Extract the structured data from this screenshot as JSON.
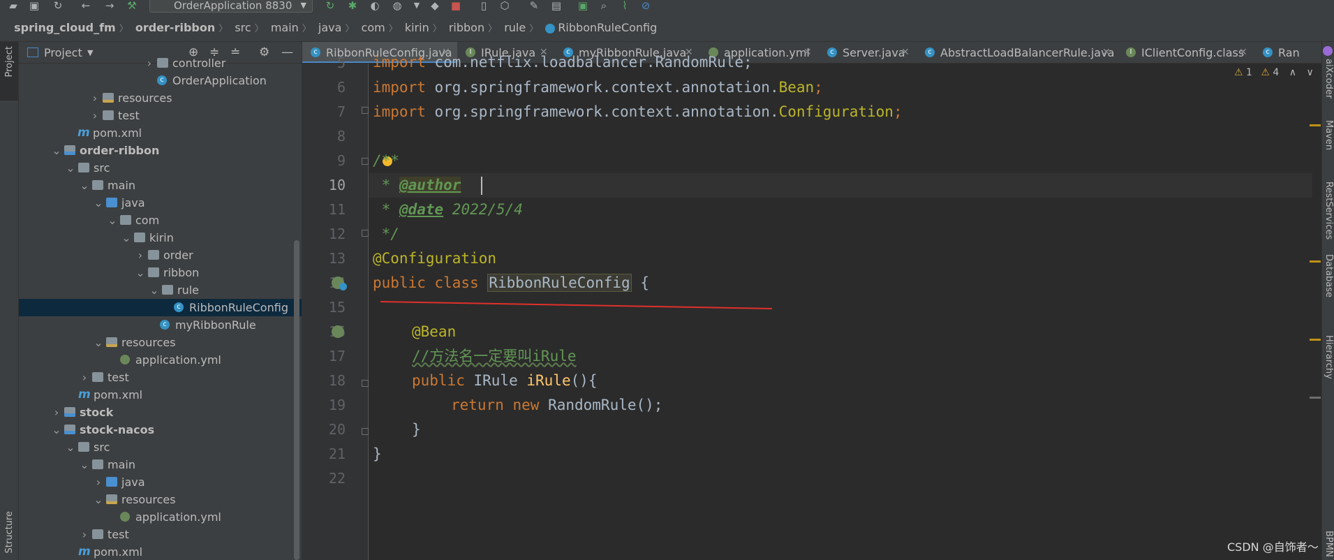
{
  "toolbar": {
    "run_config": "OrderApplication 8830"
  },
  "breadcrumb": [
    "spring_cloud_fm",
    "order-ribbon",
    "src",
    "main",
    "java",
    "com",
    "kirin",
    "ribbon",
    "rule",
    "RibbonRuleConfig"
  ],
  "left_strip": {
    "project": "Project",
    "structure": "Structure"
  },
  "project_panel": {
    "title": "Project",
    "tree": [
      {
        "label": "controller",
        "icon": "folder-icon",
        "bold": false
      },
      {
        "label": "OrderApplication",
        "icon": "spring-class-icon",
        "bold": false
      },
      {
        "label": "resources",
        "icon": "resources-folder-icon",
        "bold": false
      },
      {
        "label": "test",
        "icon": "folder-icon",
        "bold": false
      },
      {
        "label": "pom.xml",
        "icon": "maven-icon",
        "bold": false
      },
      {
        "label": "order-ribbon",
        "icon": "module-icon",
        "bold": true
      },
      {
        "label": "src",
        "icon": "folder-icon",
        "bold": false
      },
      {
        "label": "main",
        "icon": "folder-icon",
        "bold": false
      },
      {
        "label": "java",
        "icon": "source-folder-icon",
        "bold": false
      },
      {
        "label": "com",
        "icon": "package-icon",
        "bold": false
      },
      {
        "label": "kirin",
        "icon": "package-icon",
        "bold": false
      },
      {
        "label": "order",
        "icon": "package-icon",
        "bold": false
      },
      {
        "label": "ribbon",
        "icon": "package-icon",
        "bold": false
      },
      {
        "label": "rule",
        "icon": "package-icon",
        "bold": false
      },
      {
        "label": "RibbonRuleConfig",
        "icon": "class-icon",
        "bold": false
      },
      {
        "label": "myRibbonRule",
        "icon": "class-icon",
        "bold": false
      },
      {
        "label": "resources",
        "icon": "resources-folder-icon",
        "bold": false
      },
      {
        "label": "application.yml",
        "icon": "yaml-icon",
        "bold": false
      },
      {
        "label": "test",
        "icon": "folder-icon",
        "bold": false
      },
      {
        "label": "pom.xml",
        "icon": "maven-icon",
        "bold": false
      },
      {
        "label": "stock",
        "icon": "module-icon",
        "bold": true
      },
      {
        "label": "stock-nacos",
        "icon": "module-icon",
        "bold": true
      },
      {
        "label": "src",
        "icon": "folder-icon",
        "bold": false
      },
      {
        "label": "main",
        "icon": "folder-icon",
        "bold": false
      },
      {
        "label": "java",
        "icon": "source-folder-icon",
        "bold": false
      },
      {
        "label": "resources",
        "icon": "resources-folder-icon",
        "bold": false
      },
      {
        "label": "application.yml",
        "icon": "yaml-icon",
        "bold": false
      },
      {
        "label": "test",
        "icon": "folder-icon",
        "bold": false
      },
      {
        "label": "pom.xml",
        "icon": "maven-icon",
        "bold": false
      }
    ]
  },
  "tabs": [
    {
      "label": "RibbonRuleConfig.java",
      "icon": "class-icon"
    },
    {
      "label": "IRule.java",
      "icon": "interface-icon"
    },
    {
      "label": "myRibbonRule.java",
      "icon": "class-icon"
    },
    {
      "label": "application.yml",
      "icon": "yaml-icon"
    },
    {
      "label": "Server.java",
      "icon": "class-icon"
    },
    {
      "label": "AbstractLoadBalancerRule.java",
      "icon": "abstract-class-icon"
    },
    {
      "label": "IClientConfig.class",
      "icon": "interface-icon"
    },
    {
      "label": "Ran",
      "icon": "class-icon"
    }
  ],
  "problems": {
    "warnings": "1",
    "weak_warnings": "4"
  },
  "editor": {
    "line_numbers": [
      "5",
      "6",
      "7",
      "8",
      "9",
      "10",
      "11",
      "12",
      "13",
      "14",
      "15",
      "16",
      "17",
      "18",
      "19",
      "20",
      "21",
      "22"
    ],
    "current_line": "10",
    "code": {
      "l5_kw": "import",
      "l5_rest": " com.netflix.loadbalancer.RandomRule;",
      "l6_kw": "import",
      "l6_rest": " org.springframework.context.annotation.",
      "l6_cls": "Bean",
      "l6_end": ";",
      "l7_kw": "import",
      "l7_rest": " org.springframework.context.annotation.",
      "l7_cls": "Configuration",
      "l7_end": ";",
      "l9": "/**",
      "l10_star": " * ",
      "l10_tag": "@author",
      "l11_star": " * ",
      "l11_tag": "@date",
      "l11_val": " 2022/5/4",
      "l12": " */",
      "l13": "@Configuration",
      "l14_kw": "public class ",
      "l14_cls": "RibbonRuleConfig",
      "l14_end": " {",
      "l16": "@Bean",
      "l17": "//方法名一定要叫iRule",
      "l18_kw": "public ",
      "l18_type": "IRule ",
      "l18_fn": "iRule",
      "l18_end": "(){",
      "l19_kw": "return new ",
      "l19_rest": "RandomRule();",
      "l20": "}",
      "l21": "}"
    }
  },
  "right_strip": [
    "aiXcoder",
    "Maven",
    "RestServices",
    "Database",
    "Hierarchy",
    "BPMN"
  ],
  "watermark": "CSDN @自饰者～",
  "colors": {
    "keyword": "#cc7832",
    "annotation": "#bbb529",
    "doc": "#629755",
    "function": "#ffc66d",
    "selection": "#0d293e",
    "red_line": "#e0302b"
  }
}
